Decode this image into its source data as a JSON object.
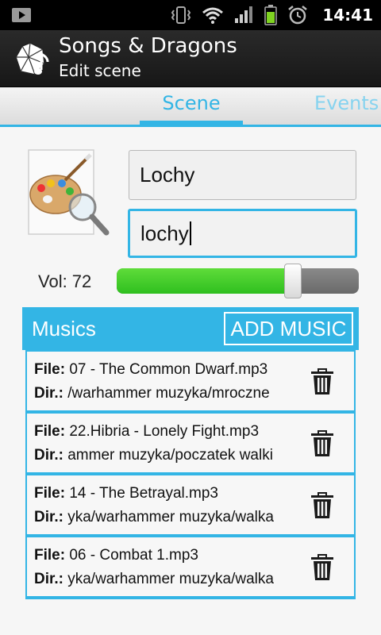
{
  "status_bar": {
    "time": "14:41",
    "icons": [
      "notification-icon",
      "vibrate-icon",
      "wifi-icon",
      "signal-icon",
      "battery-icon",
      "alarm-icon"
    ]
  },
  "app": {
    "title": "Songs & Dragons",
    "subtitle": "Edit scene"
  },
  "tabs": [
    {
      "label": "Scene",
      "selected": true
    },
    {
      "label": "Events",
      "selected": false
    }
  ],
  "scene": {
    "name": "Lochy",
    "tag": "lochy",
    "volume_label": "Vol: 72",
    "volume_value": 72,
    "volume_max": 100
  },
  "musics": {
    "title": "Musics",
    "add_label": "ADD MUSIC",
    "file_label": "File:",
    "dir_label": "Dir.:",
    "items": [
      {
        "file": "07 - The Common Dwarf.mp3",
        "dir": "/warhammer muzyka/mroczne"
      },
      {
        "file": "22.Hibria - Lonely Fight.mp3",
        "dir": "ammer muzyka/poczatek walki"
      },
      {
        "file": "14 - The Betrayal.mp3",
        "dir": "yka/warhammer muzyka/walka"
      },
      {
        "file": "06 - Combat 1.mp3",
        "dir": "yka/warhammer muzyka/walka"
      }
    ]
  },
  "colors": {
    "accent": "#33b5e5",
    "volume_fill": "#2fbf1f",
    "action_bar": "#1f1f1f"
  }
}
